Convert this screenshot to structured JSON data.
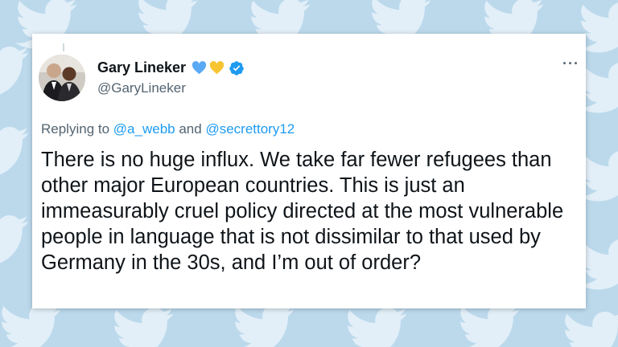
{
  "tweet": {
    "author": {
      "display_name": "Gary Lineker",
      "handle": "@GaryLineker",
      "heart_colors": [
        "#5aa9f4",
        "#f7c531"
      ],
      "verified_color": "#1d9bf0"
    },
    "reply": {
      "prefix": "Replying to",
      "mention_1": "@a_webb",
      "conjunction": "and",
      "mention_2": "@secrettory12"
    },
    "text": "There is no huge influx. We take far fewer refugees than other major European countries. This is just an immeasurably cruel policy directed at the most vulnerable people in language that is not dissimilar to that used by Germany in the 30s, and I’m out of order?",
    "more_label": "···"
  },
  "icons": {
    "more": "more-options-icon",
    "verified": "verified-badge-icon",
    "background": "twitter-bird-icon"
  }
}
